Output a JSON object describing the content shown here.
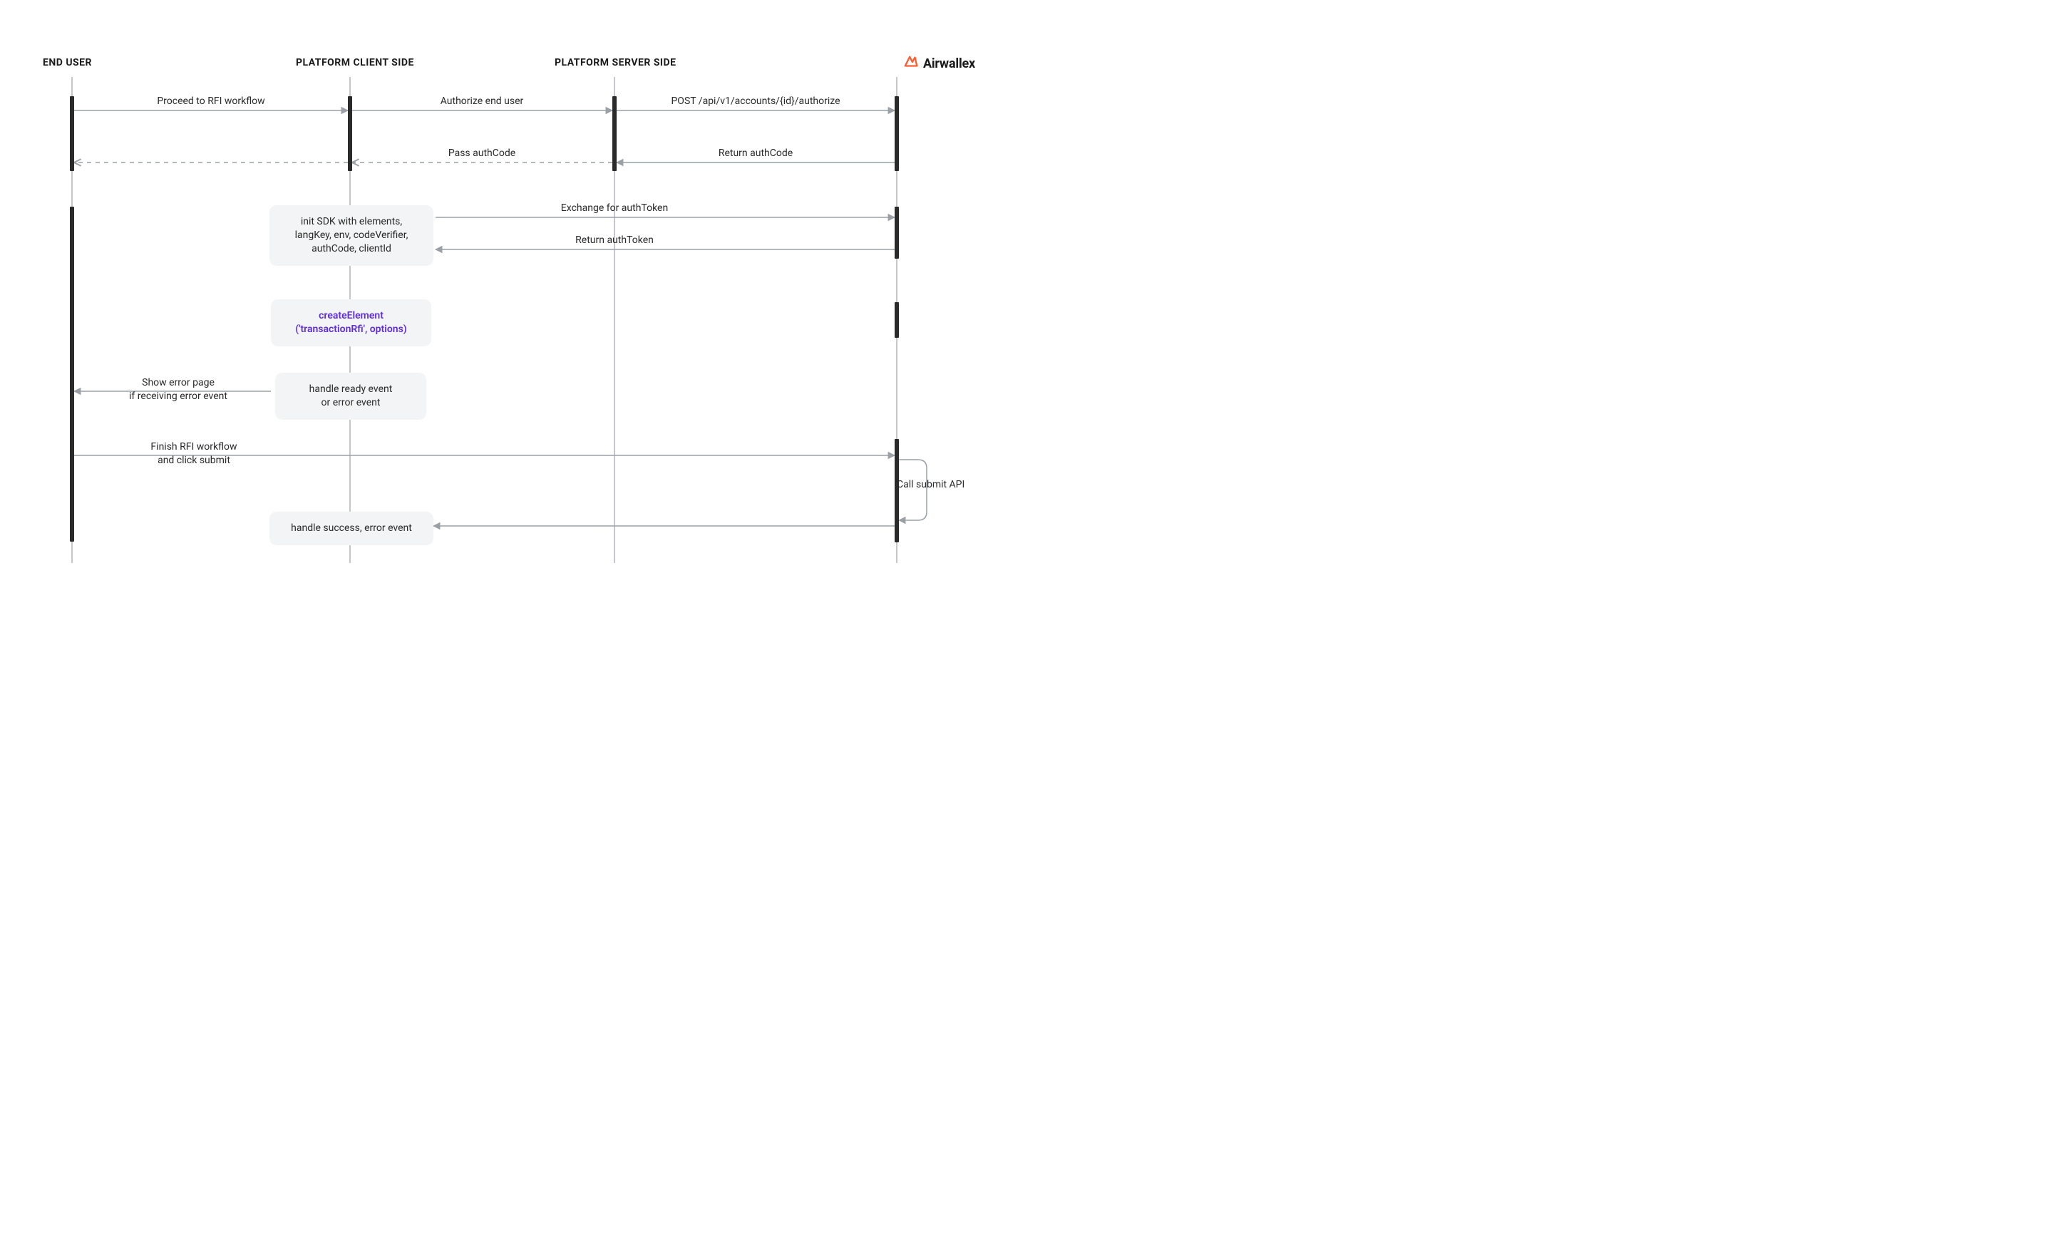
{
  "lanes": {
    "endUser": "END USER",
    "clientSide": "PLATFORM CLIENT SIDE",
    "serverSide": "PLATFORM SERVER SIDE"
  },
  "brand": {
    "name": "Airwallex"
  },
  "messages": {
    "proceed": "Proceed to RFI workflow",
    "authorize": "Authorize end user",
    "postAuthorize": "POST /api/v1/accounts/{id}/authorize",
    "passAuthCode": "Pass authCode",
    "returnAuthCode": "Return authCode",
    "initSdk": "init SDK with elements,\nlangKey, env, codeVerifier,\nauthCode, clientId",
    "exchangeToken": "Exchange for authToken",
    "returnToken": "Return authToken",
    "createElement": "createElement\n('transactionRfi', options)",
    "handleReady": "handle ready event\nor error event",
    "showErrorPage": "Show error page\nif receiving error event",
    "finishWorkflow": "Finish RFI workflow\nand click submit",
    "callSubmit": "Call submit API",
    "handleSuccess": "handle success, error event"
  }
}
